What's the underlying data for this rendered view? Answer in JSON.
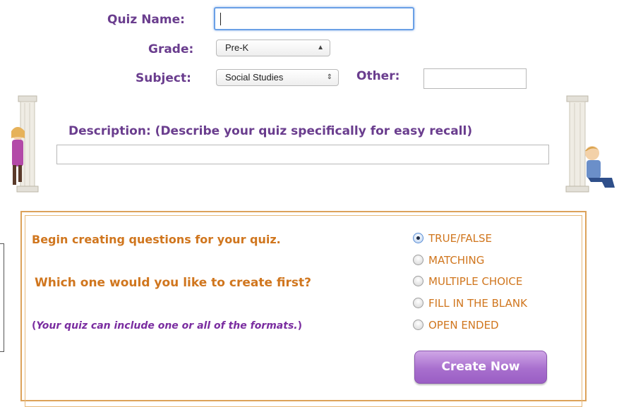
{
  "form": {
    "quiz_name_label": "Quiz Name:",
    "quiz_name_value": "",
    "grade_label": "Grade:",
    "grade_selected": "Pre-K",
    "subject_label": "Subject:",
    "subject_selected": "Social Studies",
    "other_label": "Other:",
    "other_value": "",
    "description_label": "Description: (Describe your quiz specifically for easy recall)",
    "description_value": ""
  },
  "creator": {
    "heading": "Begin creating questions for your quiz.",
    "question": "Which one would you like to create first?",
    "note_open": "(",
    "note_text": "Your quiz can include one or all of the formats.",
    "note_close": ")",
    "options": [
      {
        "label": "TRUE/FALSE",
        "checked": true
      },
      {
        "label": "MATCHING",
        "checked": false
      },
      {
        "label": "MULTIPLE CHOICE",
        "checked": false
      },
      {
        "label": "FILL IN THE BLANK",
        "checked": false
      },
      {
        "label": "OPEN ENDED",
        "checked": false
      }
    ],
    "create_button": "Create Now"
  },
  "colors": {
    "label_purple": "#6a3d8e",
    "accent_orange": "#d0761e",
    "border_orange": "#dca25a",
    "button_purple": "#a86fce"
  }
}
